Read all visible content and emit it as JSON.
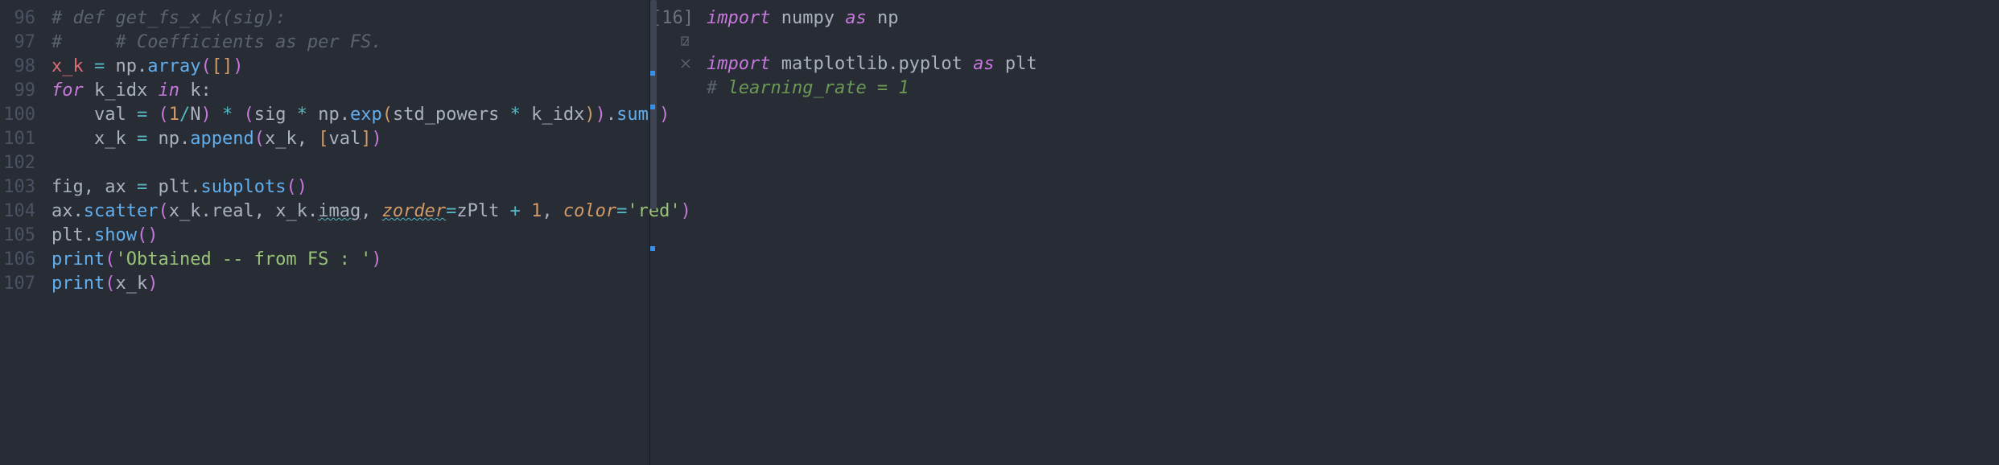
{
  "left": {
    "lineStart": 96,
    "lines": [
      {
        "n": 96,
        "tokens": [
          {
            "t": "# def get_fs_x_k(sig):",
            "c": "cm"
          }
        ]
      },
      {
        "n": 97,
        "tokens": [
          {
            "t": "#     # Coefficients as per FS.",
            "c": "cm"
          }
        ]
      },
      {
        "n": 98,
        "tokens": [
          {
            "t": "x_k",
            "c": "id"
          },
          {
            "t": " ",
            "c": "pn"
          },
          {
            "t": "=",
            "c": "op"
          },
          {
            "t": " ",
            "c": "pn"
          },
          {
            "t": "np",
            "c": "obj"
          },
          {
            "t": ".",
            "c": "pn"
          },
          {
            "t": "array",
            "c": "fn"
          },
          {
            "t": "(",
            "c": "pnB"
          },
          {
            "t": "[",
            "c": "pnY"
          },
          {
            "t": "]",
            "c": "pnY"
          },
          {
            "t": ")",
            "c": "pnB"
          }
        ]
      },
      {
        "n": 99,
        "tokens": [
          {
            "t": "for",
            "c": "kw"
          },
          {
            "t": " ",
            "c": "pn"
          },
          {
            "t": "k_idx",
            "c": "idp"
          },
          {
            "t": " ",
            "c": "pn"
          },
          {
            "t": "in",
            "c": "kw"
          },
          {
            "t": " ",
            "c": "pn"
          },
          {
            "t": "k",
            "c": "idp"
          },
          {
            "t": ":",
            "c": "pn"
          }
        ]
      },
      {
        "n": 100,
        "indent": "i2",
        "tokens": [
          {
            "t": "val",
            "c": "idp"
          },
          {
            "t": " ",
            "c": "pn"
          },
          {
            "t": "=",
            "c": "op"
          },
          {
            "t": " ",
            "c": "pn"
          },
          {
            "t": "(",
            "c": "pnB"
          },
          {
            "t": "1",
            "c": "num"
          },
          {
            "t": "/",
            "c": "op"
          },
          {
            "t": "N",
            "c": "idp"
          },
          {
            "t": ")",
            "c": "pnB"
          },
          {
            "t": " ",
            "c": "pn"
          },
          {
            "t": "*",
            "c": "op"
          },
          {
            "t": " ",
            "c": "pn"
          },
          {
            "t": "(",
            "c": "pnB"
          },
          {
            "t": "sig",
            "c": "idp"
          },
          {
            "t": " ",
            "c": "pn"
          },
          {
            "t": "*",
            "c": "op"
          },
          {
            "t": " ",
            "c": "pn"
          },
          {
            "t": "np",
            "c": "obj"
          },
          {
            "t": ".",
            "c": "pn"
          },
          {
            "t": "exp",
            "c": "fn"
          },
          {
            "t": "(",
            "c": "pnY"
          },
          {
            "t": "std_powers",
            "c": "idp"
          },
          {
            "t": " ",
            "c": "pn"
          },
          {
            "t": "*",
            "c": "op"
          },
          {
            "t": " ",
            "c": "pn"
          },
          {
            "t": "k_idx",
            "c": "idp"
          },
          {
            "t": ")",
            "c": "pnY"
          },
          {
            "t": ")",
            "c": "pnB"
          },
          {
            "t": ".",
            "c": "pn"
          },
          {
            "t": "sum",
            "c": "fn"
          },
          {
            "t": "(",
            "c": "pnB"
          },
          {
            "t": ")",
            "c": "pnB"
          }
        ]
      },
      {
        "n": 101,
        "indent": "i2",
        "tokens": [
          {
            "t": "x_k",
            "c": "idp"
          },
          {
            "t": " ",
            "c": "pn"
          },
          {
            "t": "=",
            "c": "op"
          },
          {
            "t": " ",
            "c": "pn"
          },
          {
            "t": "np",
            "c": "obj"
          },
          {
            "t": ".",
            "c": "pn"
          },
          {
            "t": "append",
            "c": "fn"
          },
          {
            "t": "(",
            "c": "pnB"
          },
          {
            "t": "x_k",
            "c": "idp"
          },
          {
            "t": ",",
            "c": "pn"
          },
          {
            "t": " ",
            "c": "pn"
          },
          {
            "t": "[",
            "c": "pnY"
          },
          {
            "t": "val",
            "c": "idp"
          },
          {
            "t": "]",
            "c": "pnY"
          },
          {
            "t": ")",
            "c": "pnB"
          }
        ]
      },
      {
        "n": 102,
        "tokens": []
      },
      {
        "n": 103,
        "tokens": [
          {
            "t": "fig",
            "c": "idp"
          },
          {
            "t": ",",
            "c": "pn"
          },
          {
            "t": " ",
            "c": "pn"
          },
          {
            "t": "ax",
            "c": "idp"
          },
          {
            "t": " ",
            "c": "pn"
          },
          {
            "t": "=",
            "c": "op"
          },
          {
            "t": " ",
            "c": "pn"
          },
          {
            "t": "plt",
            "c": "obj"
          },
          {
            "t": ".",
            "c": "pn"
          },
          {
            "t": "subplots",
            "c": "fn"
          },
          {
            "t": "(",
            "c": "pnB"
          },
          {
            "t": ")",
            "c": "pnB"
          }
        ]
      },
      {
        "n": 104,
        "tokens": [
          {
            "t": "ax",
            "c": "obj"
          },
          {
            "t": ".",
            "c": "pn"
          },
          {
            "t": "scatter",
            "c": "fn"
          },
          {
            "t": "(",
            "c": "pnB"
          },
          {
            "t": "x_k",
            "c": "idp"
          },
          {
            "t": ".",
            "c": "pn"
          },
          {
            "t": "real",
            "c": "idp"
          },
          {
            "t": ",",
            "c": "pn"
          },
          {
            "t": " ",
            "c": "pn"
          },
          {
            "t": "x_k",
            "c": "idp"
          },
          {
            "t": ".",
            "c": "pn"
          },
          {
            "t": "imag",
            "c": "idp",
            "extra": "wavy"
          },
          {
            "t": ",",
            "c": "pn"
          },
          {
            "t": " ",
            "c": "pn"
          },
          {
            "t": "zorder",
            "c": "kwarg",
            "extra": "wavy"
          },
          {
            "t": "=",
            "c": "op"
          },
          {
            "t": "zPlt",
            "c": "idp"
          },
          {
            "t": " ",
            "c": "pn"
          },
          {
            "t": "+",
            "c": "op"
          },
          {
            "t": " ",
            "c": "pn"
          },
          {
            "t": "1",
            "c": "num"
          },
          {
            "t": ",",
            "c": "pn"
          },
          {
            "t": " ",
            "c": "pn"
          },
          {
            "t": "color",
            "c": "kwarg"
          },
          {
            "t": "=",
            "c": "op"
          },
          {
            "t": "'red'",
            "c": "str"
          },
          {
            "t": ")",
            "c": "pnB"
          }
        ]
      },
      {
        "n": 105,
        "tokens": [
          {
            "t": "plt",
            "c": "obj"
          },
          {
            "t": ".",
            "c": "pn"
          },
          {
            "t": "show",
            "c": "fn"
          },
          {
            "t": "(",
            "c": "pnB"
          },
          {
            "t": ")",
            "c": "pnB"
          }
        ]
      },
      {
        "n": 106,
        "tokens": [
          {
            "t": "print",
            "c": "fn"
          },
          {
            "t": "(",
            "c": "pnB"
          },
          {
            "t": "'Obtained -- from FS : '",
            "c": "str"
          },
          {
            "t": ")",
            "c": "pnB"
          }
        ]
      },
      {
        "n": 107,
        "tokens": [
          {
            "t": "print",
            "c": "fn"
          },
          {
            "t": "(",
            "c": "pnB"
          },
          {
            "t": "x_k",
            "c": "idp"
          },
          {
            "t": ")",
            "c": "pnB"
          }
        ]
      }
    ]
  },
  "right": {
    "cellNumber": "[16]",
    "lines": [
      {
        "tokens": [
          {
            "t": "import",
            "c": "kw"
          },
          {
            "t": " ",
            "c": "pn"
          },
          {
            "t": "numpy",
            "c": "idp"
          },
          {
            "t": " ",
            "c": "pn"
          },
          {
            "t": "as",
            "c": "kw"
          },
          {
            "t": " ",
            "c": "pn"
          },
          {
            "t": "np",
            "c": "idp"
          }
        ]
      },
      {
        "short": true,
        "tokens": []
      },
      {
        "tokens": [
          {
            "t": "import",
            "c": "kw"
          },
          {
            "t": " ",
            "c": "pn"
          },
          {
            "t": "matplotlib",
            "c": "idp"
          },
          {
            "t": ".",
            "c": "pn"
          },
          {
            "t": "pyplot",
            "c": "idp"
          },
          {
            "t": " ",
            "c": "pn"
          },
          {
            "t": "as",
            "c": "kw"
          },
          {
            "t": " ",
            "c": "pn"
          },
          {
            "t": "plt",
            "c": "idp"
          }
        ]
      },
      {
        "tokens": [
          {
            "t": "# ",
            "c": "cm2"
          },
          {
            "t": "learning_rate = 1",
            "c": "cm2-hl"
          }
        ]
      }
    ],
    "markers": [
      88,
      130,
      306
    ]
  }
}
